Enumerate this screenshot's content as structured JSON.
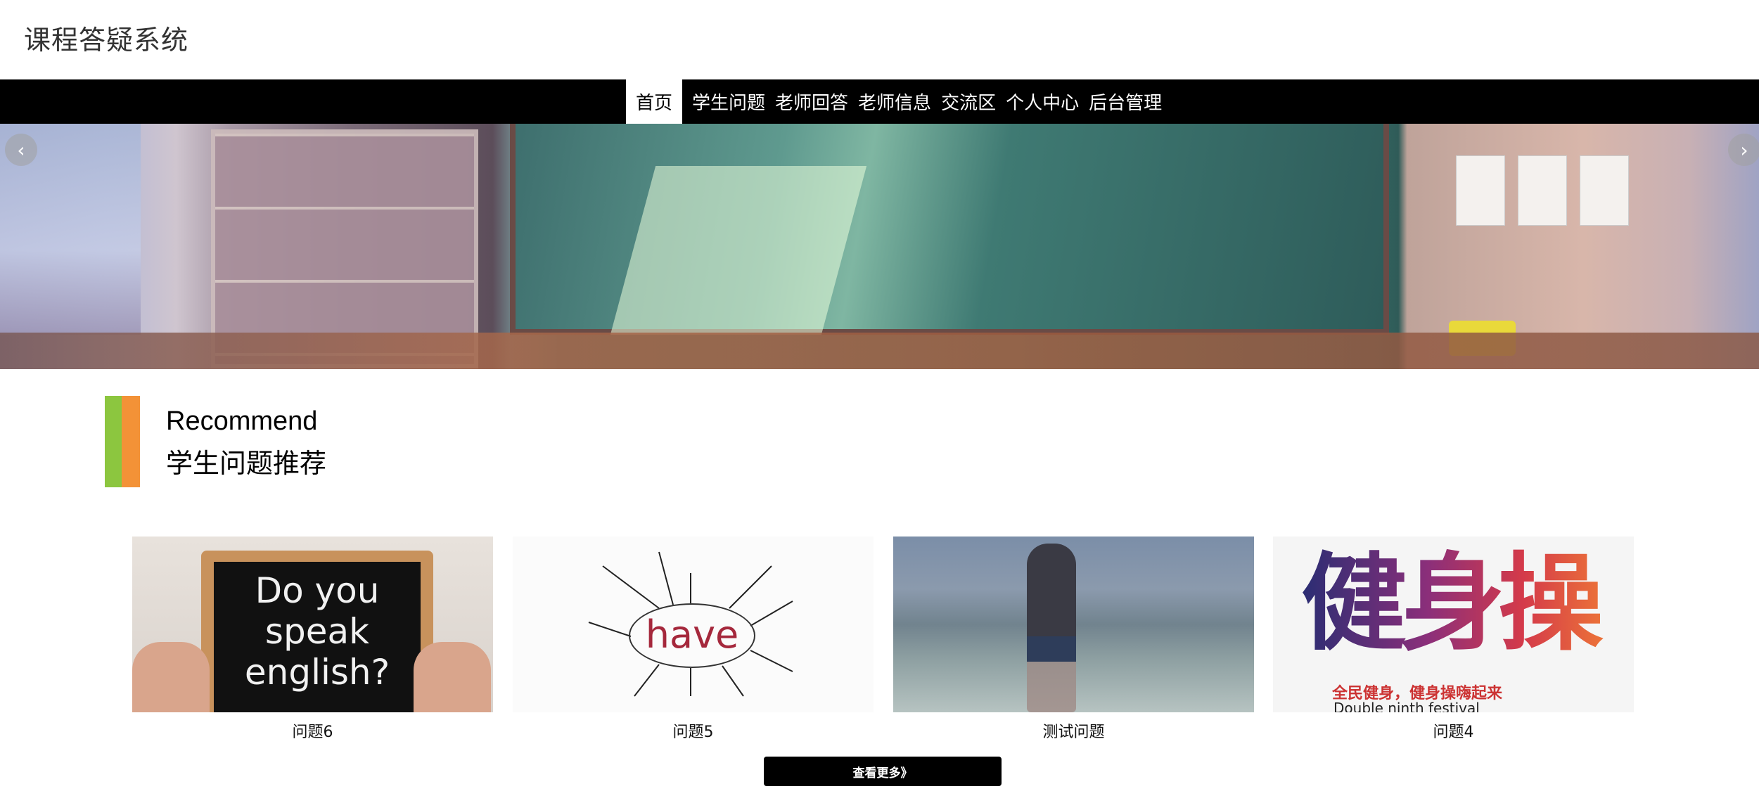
{
  "header": {
    "title": "课程答疑系统"
  },
  "nav": {
    "items": [
      {
        "label": "首页",
        "active": true
      },
      {
        "label": "学生问题",
        "active": false
      },
      {
        "label": "老师回答",
        "active": false
      },
      {
        "label": "老师信息",
        "active": false
      },
      {
        "label": "交流区",
        "active": false
      },
      {
        "label": "个人中心",
        "active": false
      },
      {
        "label": "后台管理",
        "active": false
      }
    ]
  },
  "banner": {
    "prev_icon": "chevron-left-icon",
    "next_icon": "chevron-right-icon",
    "prev_glyph": "‹",
    "next_glyph": "›",
    "slide_count": 4,
    "active_slide": 1
  },
  "recommend": {
    "title_en": "Recommend",
    "title_cn": "学生问题推荐",
    "colors": {
      "green": "#8cc63f",
      "orange": "#f39237"
    }
  },
  "cards": [
    {
      "caption": "问题6",
      "image_text": "Do you\nspeak\nenglish?"
    },
    {
      "caption": "问题5",
      "image_text": "have"
    },
    {
      "caption": "测试问题"
    },
    {
      "caption": "问题4",
      "image_text": "健身操",
      "image_slogan": "全民健身，健身操嗨起来",
      "image_slogan_en": "Double ninth festival"
    }
  ],
  "more_button": {
    "label": "查看更多》"
  }
}
